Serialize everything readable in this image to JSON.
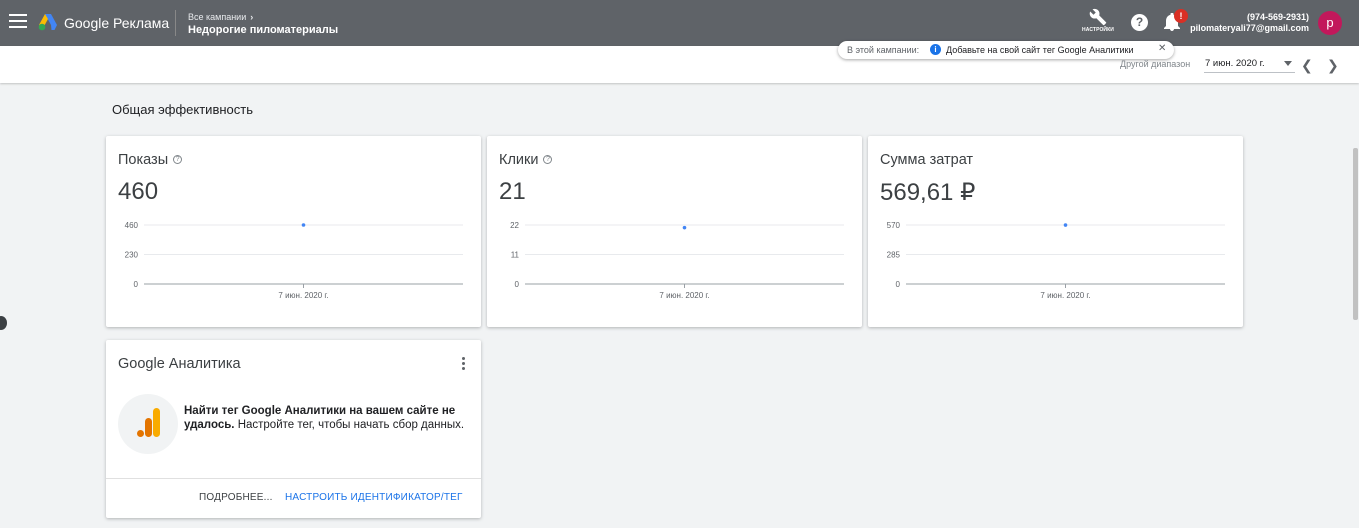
{
  "header": {
    "logo_text": "Google Реклама",
    "breadcrumb_parent": "Все кампании",
    "campaign_name": "Недорогие пиломатериалы",
    "tools_label": "НАСТРОЙКИ",
    "help_symbol": "?",
    "notification_badge": "!",
    "account_phone": "(974-569-2931)",
    "account_email": "pilomateryali77@gmail.com",
    "avatar_letter": "p"
  },
  "notice": {
    "prefix": "В этой кампании:",
    "text": "Добавьте на свой сайт тег Google Аналитики",
    "close": "✕"
  },
  "date_range": {
    "label": "Другой диапазон",
    "value": "7 июн. 2020 г."
  },
  "section_title": "Общая эффективность",
  "cards": [
    {
      "title": "Показы",
      "value": "460"
    },
    {
      "title": "Клики",
      "value": "21"
    },
    {
      "title": "Сумма затрат",
      "value": "569,61 ₽"
    }
  ],
  "chart_data": [
    {
      "type": "scatter",
      "categories": [
        "7 июн. 2020 г."
      ],
      "values": [
        460
      ],
      "yticks": [
        "460",
        "230",
        "0"
      ],
      "ylim": [
        0,
        460
      ]
    },
    {
      "type": "scatter",
      "categories": [
        "7 июн. 2020 г."
      ],
      "values": [
        21
      ],
      "yticks": [
        "22",
        "11",
        "0"
      ],
      "ylim": [
        0,
        22
      ]
    },
    {
      "type": "scatter",
      "categories": [
        "7 июн. 2020 г."
      ],
      "values": [
        569.61
      ],
      "yticks": [
        "570",
        "285",
        "0"
      ],
      "ylim": [
        0,
        570
      ]
    }
  ],
  "colors": {
    "point": "#4285f4",
    "header_bg": "#5f6368",
    "link": "#1a73e8",
    "avatar": "#c2185b"
  },
  "analytics": {
    "title": "Google Аналитика",
    "message_bold": "Найти тег Google Аналитики на вашем сайте не удалось.",
    "message_rest": " Настройте тег, чтобы начать сбор данных.",
    "more_button": "ПОДРОБНЕЕ...",
    "setup_button": "НАСТРОИТЬ ИДЕНТИФИКАТОР/ТЕГ"
  }
}
